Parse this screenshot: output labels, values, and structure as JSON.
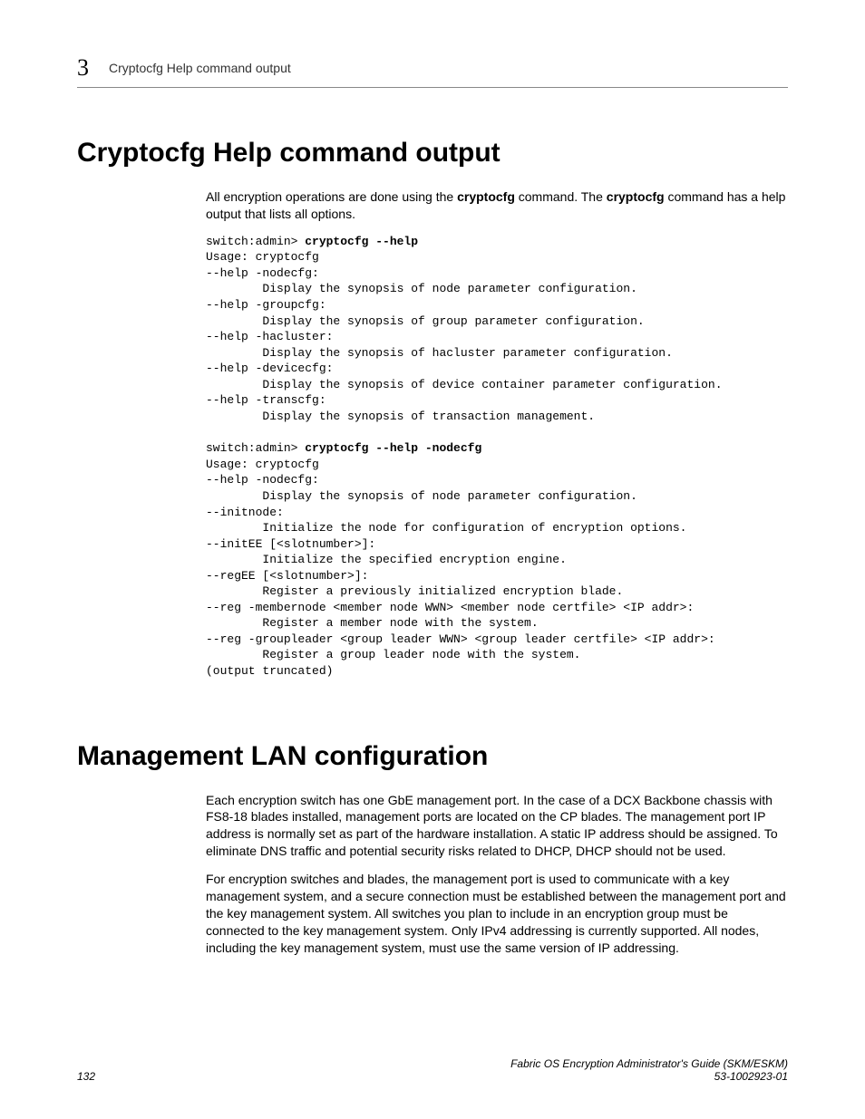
{
  "header": {
    "chapter_number": "3",
    "running_title": "Cryptocfg Help command output"
  },
  "section1": {
    "title": "Cryptocfg Help command output",
    "intro_pre": "All encryption operations are done using the ",
    "intro_bold1": "cryptocfg",
    "intro_mid": " command. The ",
    "intro_bold2": "cryptocfg",
    "intro_post": " command has a help output that lists all options.",
    "code1_prompt": "switch:admin> ",
    "code1_cmd": "cryptocfg --help",
    "code1_body": "Usage: cryptocfg\n--help -nodecfg:\n        Display the synopsis of node parameter configuration.\n--help -groupcfg:\n        Display the synopsis of group parameter configuration.\n--help -hacluster:\n        Display the synopsis of hacluster parameter configuration.\n--help -devicecfg:\n        Display the synopsis of device container parameter configuration.\n--help -transcfg:\n        Display the synopsis of transaction management.",
    "code2_prompt": "switch:admin> ",
    "code2_cmd": "cryptocfg --help -nodecfg",
    "code2_body": "Usage: cryptocfg\n--help -nodecfg:\n        Display the synopsis of node parameter configuration.\n--initnode:\n        Initialize the node for configuration of encryption options.\n--initEE [<slotnumber>]:\n        Initialize the specified encryption engine.\n--regEE [<slotnumber>]:\n        Register a previously initialized encryption blade.\n--reg -membernode <member node WWN> <member node certfile> <IP addr>:\n        Register a member node with the system.\n--reg -groupleader <group leader WWN> <group leader certfile> <IP addr>:\n        Register a group leader node with the system.\n(output truncated)"
  },
  "section2": {
    "title": "Management LAN configuration",
    "para1": "Each encryption switch has one GbE management port. In the case of a DCX Backbone chassis with FS8-18 blades installed, management ports are located on the CP blades. The management port IP address is normally set as part of the hardware installation. A static IP address should be assigned. To eliminate DNS traffic and potential security risks related to DHCP, DHCP should not be used.",
    "para2": "For encryption switches and blades, the management port is used to communicate with a key management system, and a secure connection must be established between the management port and the key management system. All switches you plan to include in an encryption group must be connected to the key management system. Only IPv4 addressing is currently supported. All nodes, including the key management system, must use the same version of IP addressing."
  },
  "footer": {
    "page_number": "132",
    "doc_title": "Fabric OS Encryption Administrator's Guide (SKM/ESKM)",
    "doc_number": "53-1002923-01"
  }
}
